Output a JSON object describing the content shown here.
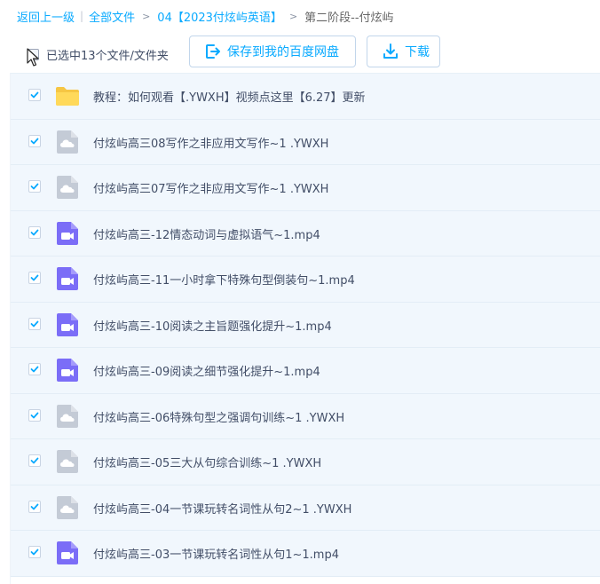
{
  "breadcrumb": {
    "back": "返回上一级",
    "all_files": "全部文件",
    "folder": "04【2023付炫屿英语】",
    "current": "第二阶段--付炫屿"
  },
  "toolbar": {
    "selected_text": "已选中13个文件/文件夹",
    "save_label": "保存到我的百度网盘",
    "download_label": "下载"
  },
  "colors": {
    "accent": "#09aaff",
    "row_selected": "#f1f7fd",
    "folder": "#ffd95a",
    "video": "#7b6df7",
    "cloud": "#c4cbd6"
  },
  "files": [
    {
      "name": "教程：如何观看【.YWXH】视频点这里【6.27】更新",
      "icon": "folder-icon",
      "checked": true
    },
    {
      "name": "付炫屿高三08写作之非应用文写作~1 .YWXH",
      "icon": "cloud-file-icon",
      "checked": true
    },
    {
      "name": "付炫屿高三07写作之非应用文写作~1 .YWXH",
      "icon": "cloud-file-icon",
      "checked": true
    },
    {
      "name": "付炫屿高三-12情态动词与虚拟语气~1.mp4",
      "icon": "video-file-icon",
      "checked": true
    },
    {
      "name": "付炫屿高三-11一小时拿下特殊句型倒装句~1.mp4",
      "icon": "video-file-icon",
      "checked": true
    },
    {
      "name": "付炫屿高三-10阅读之主旨题强化提升~1.mp4",
      "icon": "video-file-icon",
      "checked": true
    },
    {
      "name": "付炫屿高三-09阅读之细节强化提升~1.mp4",
      "icon": "video-file-icon",
      "checked": true
    },
    {
      "name": "付炫屿高三-06特殊句型之强调句训练~1 .YWXH",
      "icon": "cloud-file-icon",
      "checked": true
    },
    {
      "name": "付炫屿高三-05三大从句综合训练~1 .YWXH",
      "icon": "cloud-file-icon",
      "checked": true
    },
    {
      "name": "付炫屿高三-04一节课玩转名词性从句2~1 .YWXH",
      "icon": "cloud-file-icon",
      "checked": true
    },
    {
      "name": "付炫屿高三-03一节课玩转名词性从句1~1.mp4",
      "icon": "video-file-icon",
      "checked": true
    }
  ]
}
